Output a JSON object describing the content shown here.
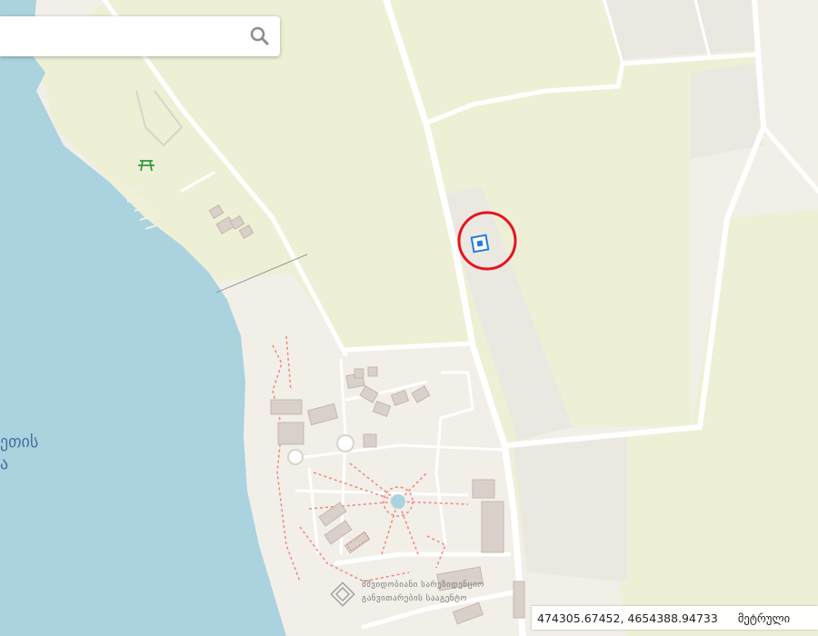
{
  "search": {
    "value": "",
    "placeholder": ""
  },
  "icons": {
    "search": "magnifier-icon",
    "picnic": "picnic-table-icon",
    "marker": "square-marker-icon",
    "institution": "institution-logo-icon"
  },
  "map": {
    "water_label": [
      "ეთის",
      "ა"
    ],
    "institution_label": [
      "მშვიდობიანი სარეზიდენციო",
      "განვითარების სააგენტო"
    ]
  },
  "status": {
    "coordinates": "474305.67452, 4654388.94733",
    "unit": "მეტრული"
  },
  "colors": {
    "water": "#aad3df",
    "grass": "#eef0d5",
    "land": "#f2efe9",
    "road": "#ffffff",
    "building": "#d9d0c9",
    "marker": "#1f7ee0",
    "highlight": "#e8141e",
    "path": "#f2857a"
  }
}
